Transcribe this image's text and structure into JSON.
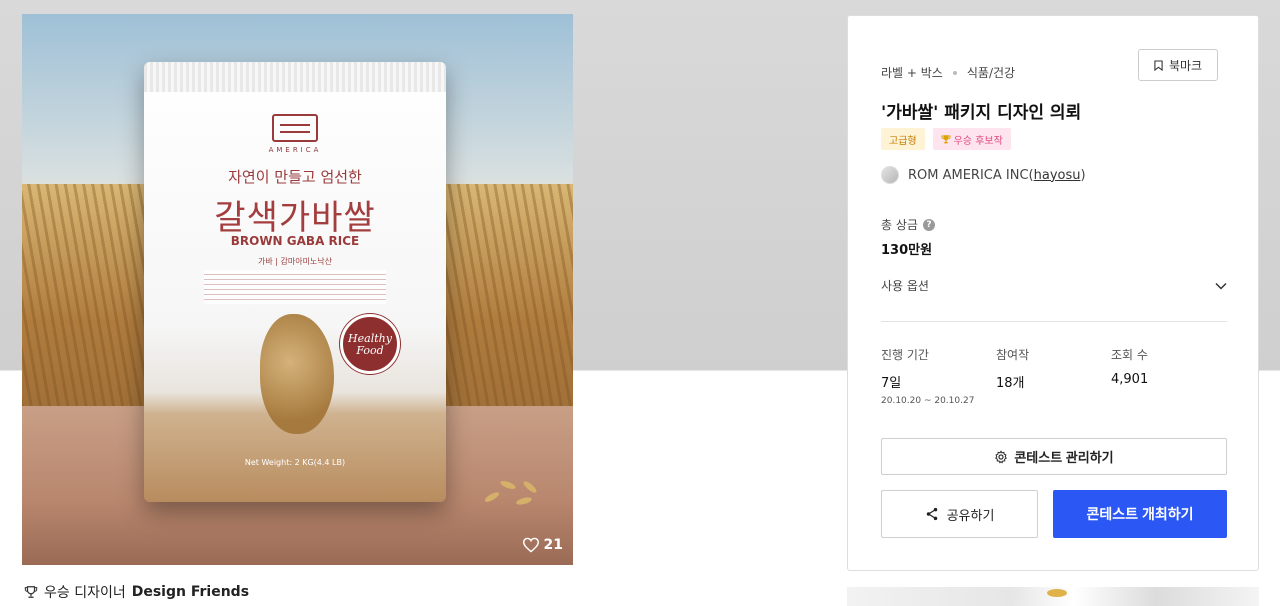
{
  "product_image": {
    "bag": {
      "brand": "AMERICA",
      "tagline": "자연이 만들고 엄선한",
      "title": "갈색가바쌀",
      "subtitle": "BROWN GABA RICE",
      "small_text": "가바 | 감마아미노낙산",
      "badge_line1": "Healthy",
      "badge_line2": "Food",
      "net_weight": "Net Weight: 2 KG(4.4 LB)"
    },
    "likes": "21",
    "heart_icon": "heart-icon"
  },
  "winner": {
    "prefix": "우승 디자이너",
    "name": "Design Friends",
    "icon": "trophy-icon"
  },
  "panel": {
    "bookmark_label": "북마크",
    "category": "라벨 + 박스",
    "subcategory": "식품/건강",
    "title": "'가바쌀' 패키지 디자인 의뢰",
    "tags": {
      "grade": "고급형",
      "award": "우승 후보작",
      "award_icon": "trophy-icon"
    },
    "owner": {
      "name": "ROM AMERICA INC",
      "handle": "hayosu"
    },
    "prize_label": "총 상금",
    "prize_help": "?",
    "prize_value": "130만원",
    "usage_option_label": "사용 옵션",
    "stats": {
      "period_label": "진행 기간",
      "period_value": "7일",
      "period_range": "20.10.20 ~ 20.10.27",
      "entries_label": "참여작",
      "entries_value": "18개",
      "views_label": "조회 수",
      "views_value": "4,901"
    },
    "manage_label": "콘테스트 관리하기",
    "share_label": "공유하기",
    "host_label": "콘테스트 개최하기"
  },
  "colors": {
    "primary": "#2b57f5",
    "grade_bg": "#fff3d6",
    "grade_text": "#c47c00",
    "award_bg": "#fde4ef",
    "award_text": "#e04a7e"
  }
}
